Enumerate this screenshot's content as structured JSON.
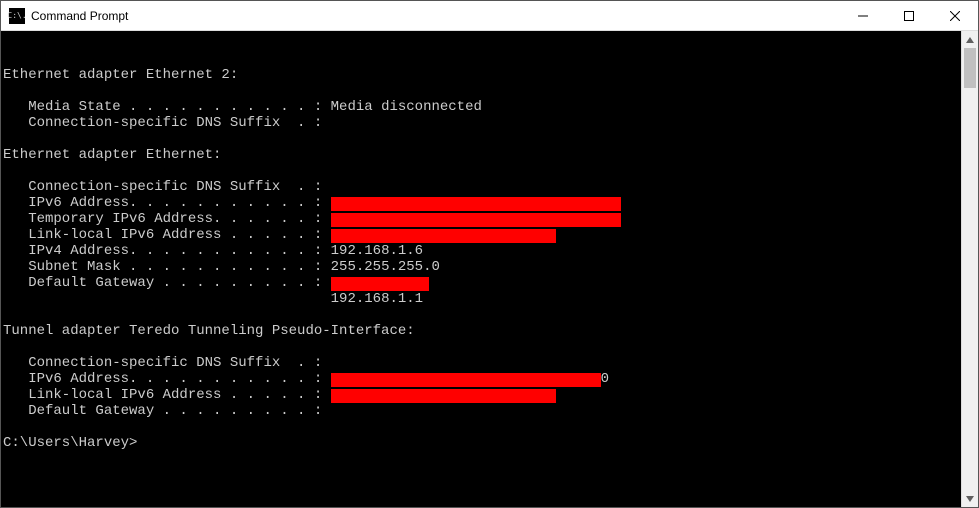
{
  "window": {
    "title": "Command Prompt",
    "icon_text": "C:\\."
  },
  "term": {
    "blank": "",
    "sec1_head": "Ethernet adapter Ethernet 2:",
    "sec1_media": "   Media State . . . . . . . . . . . : ",
    "sec1_media_val": "Media disconnected",
    "sec1_dns": "   Connection-specific DNS Suffix  . :",
    "sec2_head": "Ethernet adapter Ethernet:",
    "sec2_dns": "   Connection-specific DNS Suffix  . :",
    "sec2_ipv6": "   IPv6 Address. . . . . . . . . . . : ",
    "sec2_tmp": "   Temporary IPv6 Address. . . . . . : ",
    "sec2_ll": "   Link-local IPv6 Address . . . . . : ",
    "sec2_ipv4": "   IPv4 Address. . . . . . . . . . . : ",
    "sec2_ipv4_val": "192.168.1.6",
    "sec2_mask": "   Subnet Mask . . . . . . . . . . . : ",
    "sec2_mask_val": "255.255.255.0",
    "sec2_gw": "   Default Gateway . . . . . . . . . : ",
    "sec2_gw_pad": "                                       ",
    "sec2_gw_val": "192.168.1.1",
    "sec3_head": "Tunnel adapter Teredo Tunneling Pseudo-Interface:",
    "sec3_dns": "   Connection-specific DNS Suffix  . :",
    "sec3_ipv6": "   IPv6 Address. . . . . . . . . . . : ",
    "sec3_ipv6_trail": "0",
    "sec3_ll": "   Link-local IPv6 Address . . . . . : ",
    "sec3_gw": "   Default Gateway . . . . . . . . . :",
    "prompt": "C:\\Users\\Harvey>"
  }
}
